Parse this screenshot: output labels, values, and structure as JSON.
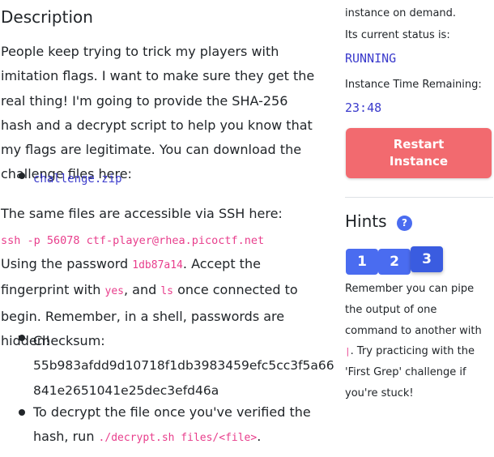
{
  "description": {
    "heading_cut": "Description",
    "heading": "Description",
    "intro": "People keep trying to trick my players with imitation flags. I want to make sure they get the real thing! I'm going to provide the SHA-256 hash and a decrypt script to help you know that my flags are legitimate. You can download the challenge files here:",
    "download_link": "challenge.zip",
    "ssh_intro": "The same files are accessible via SSH here:",
    "ssh_command": "ssh -p 56078 ctf-player@rhea.picoctf.net",
    "password_prefix": "Using the password ",
    "password": "1db87a14",
    "fingerprint_text": ". Accept the fingerprint with ",
    "yes_code": "yes",
    "and_text": ", and ",
    "ls_code": "ls",
    "once_text": " once connected to begin. Remember, in a shell, passwords are hidden!",
    "checksum_label": "Checksum:",
    "checksum_line1": "55b983afdd9d10718f1db3983459efc5cc3f5a66",
    "checksum_line2": "841e2651041e25dec3efd46a",
    "decrypt_prefix": "To decrypt the file once you've verified the hash, run ",
    "decrypt_code": "./decrypt.sh files/<file>",
    "decrypt_suffix": "."
  },
  "sidebar": {
    "instance_text_cut": "instance on demand.",
    "status_label": "Its current status is:",
    "status": "RUNNING",
    "time_label": "Instance Time Remaining:",
    "time": "23:48",
    "restart_line1": "Restart",
    "restart_line2": "Instance",
    "hints_title": "Hints",
    "help_glyph": "?",
    "hint_tabs": [
      "1",
      "2",
      "3"
    ],
    "hint_pre": "Remember you can pipe the output of one command to another with ",
    "hint_pipe": "|",
    "hint_post": ". Try practicing with the 'First Grep' challenge if you're stuck!"
  },
  "colors": {
    "code_pink": "#e83e8c",
    "link_blue": "#3b3bcc",
    "button_red": "#f26a6f",
    "hint_blue": "#4a6cf0"
  }
}
